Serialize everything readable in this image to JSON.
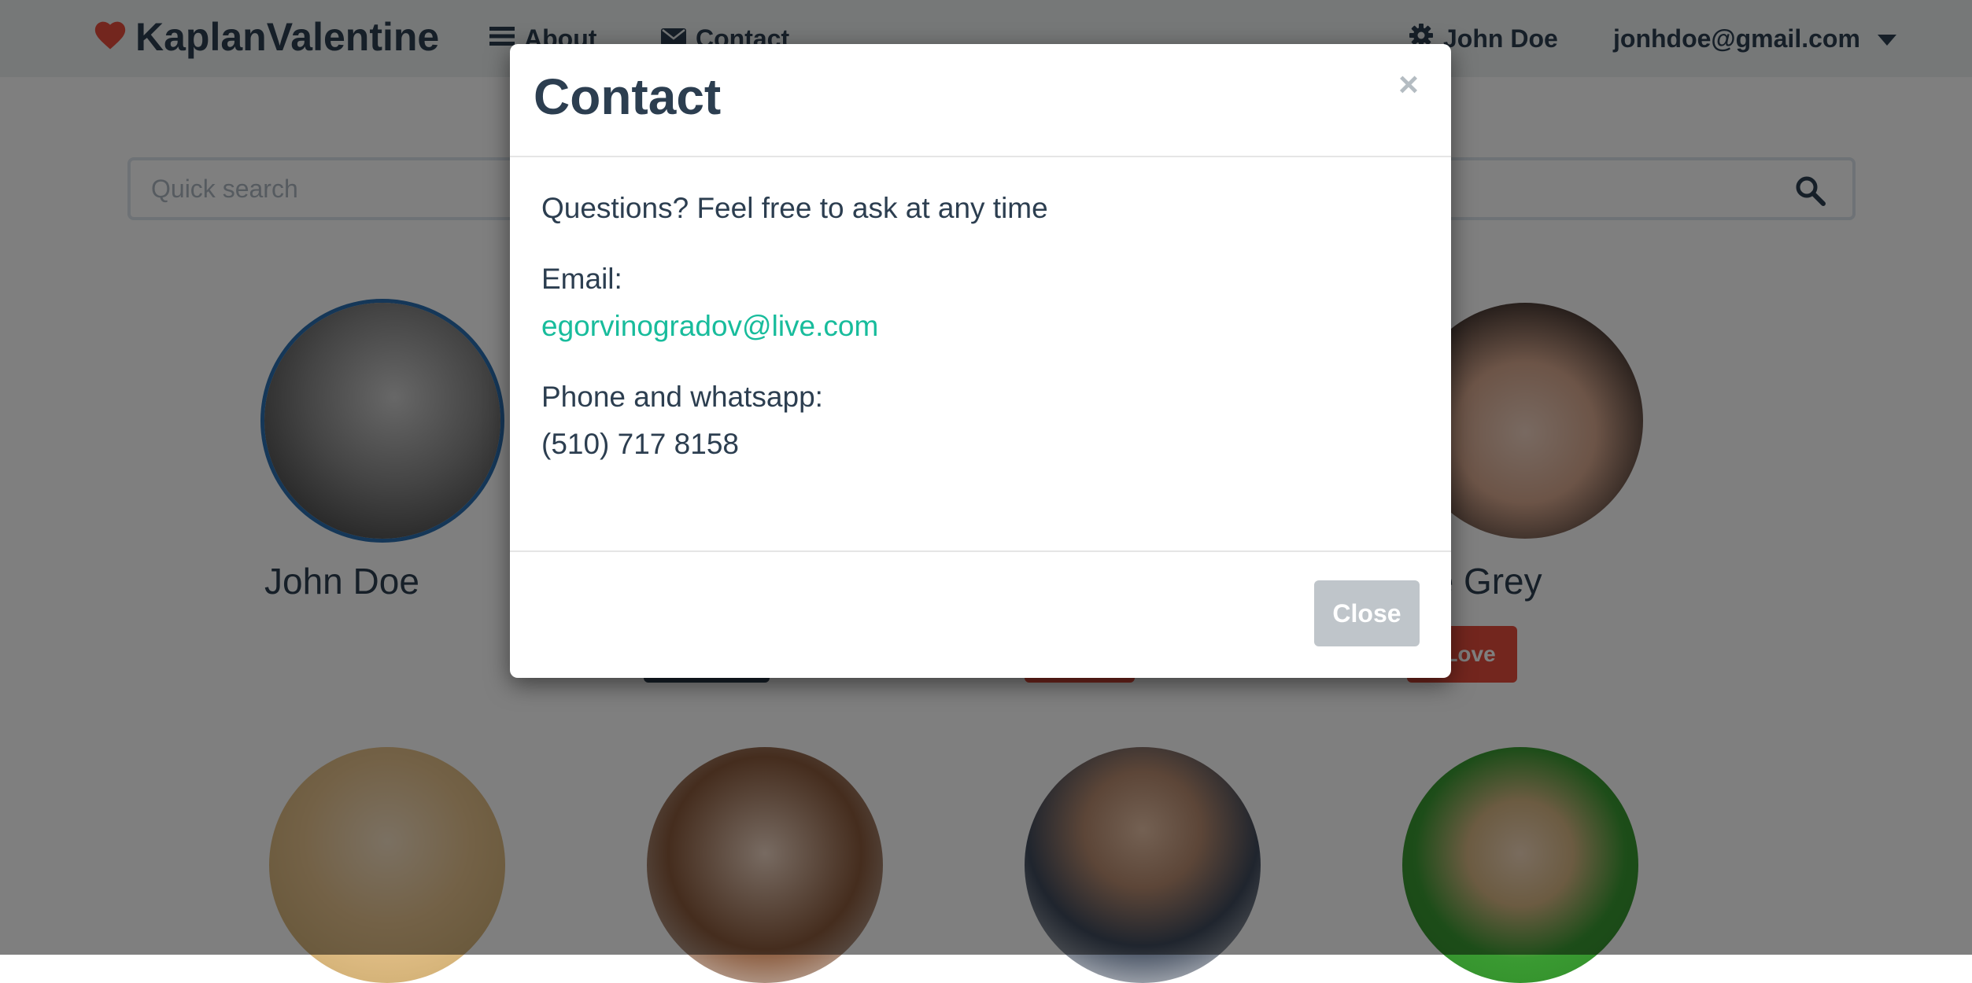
{
  "navbar": {
    "brand": "KaplanValentine",
    "links": [
      {
        "label": "About",
        "icon": "menu-icon"
      },
      {
        "label": "Contact",
        "icon": "envelope-icon"
      }
    ],
    "user_name": "John Doe",
    "user_email": "jonhdoe@gmail.com"
  },
  "search": {
    "placeholder": "Quick search"
  },
  "cards": [
    {
      "name": "John Doe",
      "button": ""
    },
    {
      "name": "",
      "button": ""
    },
    {
      "name": "",
      "button": ""
    },
    {
      "name": "ne Grey",
      "button": "Love"
    }
  ],
  "modal": {
    "title": "Contact",
    "close_x": "×",
    "intro": "Questions? Feel free to ask at any time",
    "email_label": "Email:",
    "email": "egorvinogradov@live.com",
    "phone_label": "Phone and whatsapp:",
    "phone": "(510) 717 8158",
    "close_button": "Close"
  },
  "colors": {
    "brand_heart": "#e74c3c",
    "link": "#18bc9c",
    "primary_text": "#2c3e50",
    "love_button": "#e74c3c"
  }
}
